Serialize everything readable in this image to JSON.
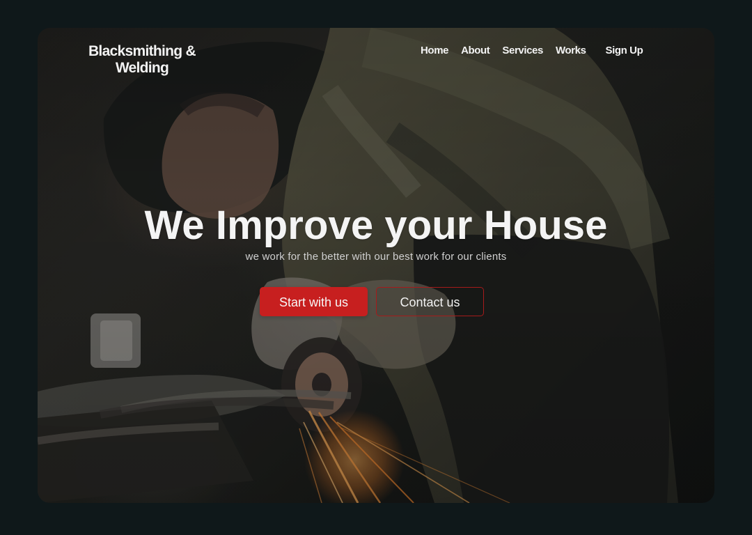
{
  "brand": {
    "name_line1": "Blacksmithing &",
    "name_line2": "Welding"
  },
  "nav": {
    "items": [
      {
        "label": "Home"
      },
      {
        "label": "About"
      },
      {
        "label": "Services"
      },
      {
        "label": "Works"
      }
    ],
    "signup": "Sign Up"
  },
  "hero": {
    "title": "We Improve your House",
    "subtitle": "we work for the better with our best work for our clients",
    "primary_cta": "Start with us",
    "secondary_cta": "Contact us"
  },
  "colors": {
    "page_background": "#0f181a",
    "accent_red": "#c71f1f",
    "accent_red_border": "#a71b1b",
    "text_light": "#f3f3f3"
  }
}
